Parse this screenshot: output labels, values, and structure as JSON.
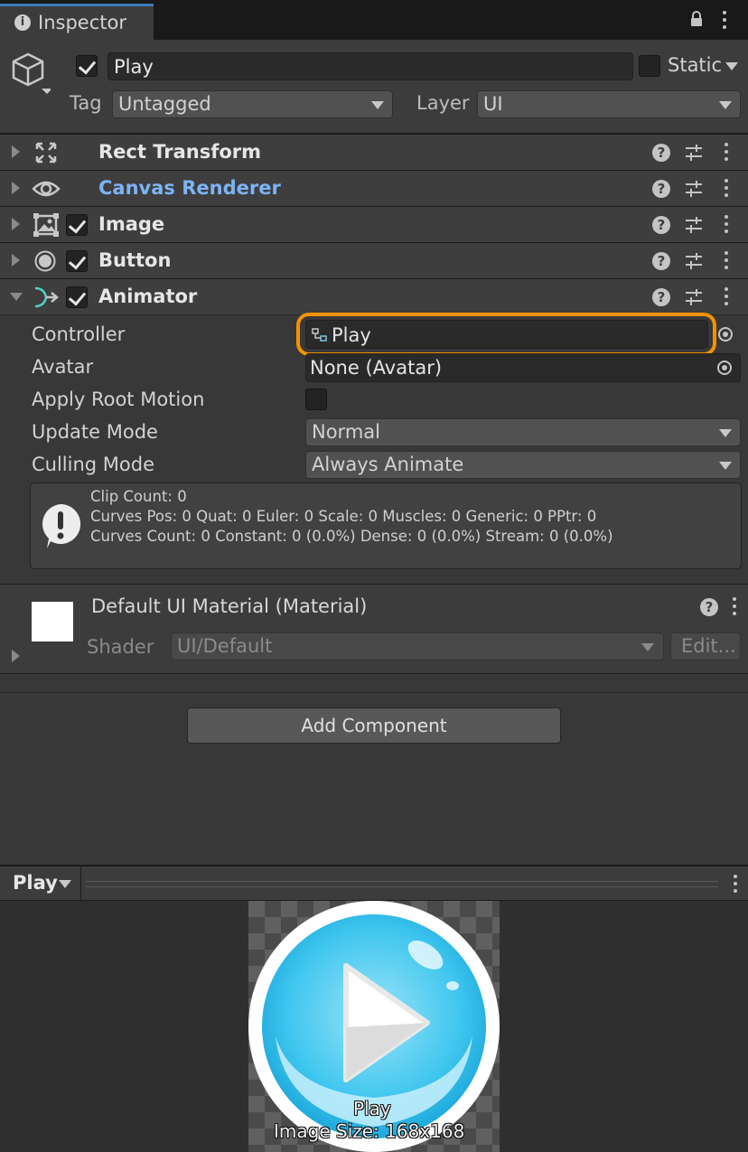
{
  "tab": {
    "title": "Inspector",
    "icon": "info-icon"
  },
  "header": {
    "object_name": "Play",
    "active": true,
    "static_label": "Static",
    "static": false,
    "tag_label": "Tag",
    "tag_value": "Untagged",
    "layer_label": "Layer",
    "layer_value": "UI"
  },
  "components": [
    {
      "name": "Rect Transform",
      "icon": "rect-transform-icon",
      "has_toggle": false,
      "expanded": false
    },
    {
      "name": "Canvas Renderer",
      "icon": "eye-icon",
      "has_toggle": false,
      "expanded": false,
      "color": "#7cb3f5"
    },
    {
      "name": "Image",
      "icon": "image-icon",
      "has_toggle": true,
      "enabled": true,
      "expanded": false
    },
    {
      "name": "Button",
      "icon": "button-icon",
      "has_toggle": true,
      "enabled": true,
      "expanded": false
    },
    {
      "name": "Animator",
      "icon": "animator-icon",
      "has_toggle": true,
      "enabled": true,
      "expanded": true
    }
  ],
  "animator": {
    "controller_label": "Controller",
    "controller_value": "Play",
    "avatar_label": "Avatar",
    "avatar_value": "None (Avatar)",
    "root_motion_label": "Apply Root Motion",
    "root_motion": false,
    "update_mode_label": "Update Mode",
    "update_mode_value": "Normal",
    "culling_mode_label": "Culling Mode",
    "culling_mode_value": "Always Animate",
    "info_line1": "Clip Count: 0",
    "info_line2": "Curves Pos: 0 Quat: 0 Euler: 0 Scale: 0 Muscles: 0 Generic: 0 PPtr: 0",
    "info_line3": "Curves Count: 0 Constant: 0 (0.0%) Dense: 0 (0.0%) Stream: 0 (0.0%)"
  },
  "material": {
    "title": "Default UI Material (Material)",
    "shader_label": "Shader",
    "shader_value": "UI/Default",
    "edit_label": "Edit..."
  },
  "add_component_label": "Add Component",
  "preview": {
    "title": "Play",
    "caption_name": "Play",
    "caption_size": "Image Size: 168x168"
  },
  "colors": {
    "highlight": "#f39200",
    "link_blue": "#7cb3f5",
    "tab_accent": "#3a79bb"
  }
}
